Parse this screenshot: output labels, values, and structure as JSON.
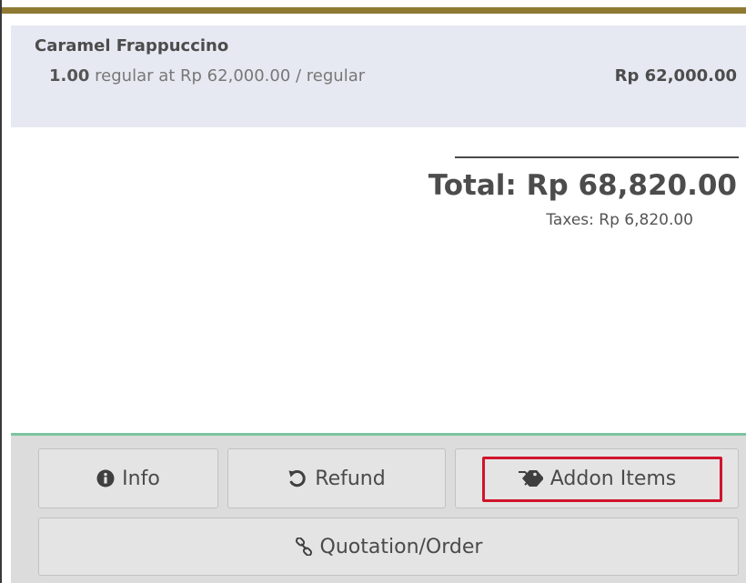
{
  "order": {
    "line": {
      "product": "Caramel Frappuccino",
      "quantity": "1.00",
      "unit_info": "regular at Rp 62,000.00 / regular",
      "price": "Rp 62,000.00"
    },
    "total_label": "Total: Rp 68,820.00",
    "taxes_label": "Taxes: Rp 6,820.00"
  },
  "controls": {
    "info_label": "Info",
    "refund_label": "Refund",
    "addon_label": "Addon Items",
    "quotation_label": "Quotation/Order"
  },
  "icons": {
    "info": "info-circle-icon",
    "refund": "undo-icon",
    "addon": "tags-icon",
    "quotation": "link-icon"
  },
  "colors": {
    "top_bar": "#8f7a33",
    "orderline_bg": "#e7e9f2",
    "divider": "#7cc4a0",
    "highlight": "#d0142c",
    "button_bg": "#e4e4e4"
  }
}
